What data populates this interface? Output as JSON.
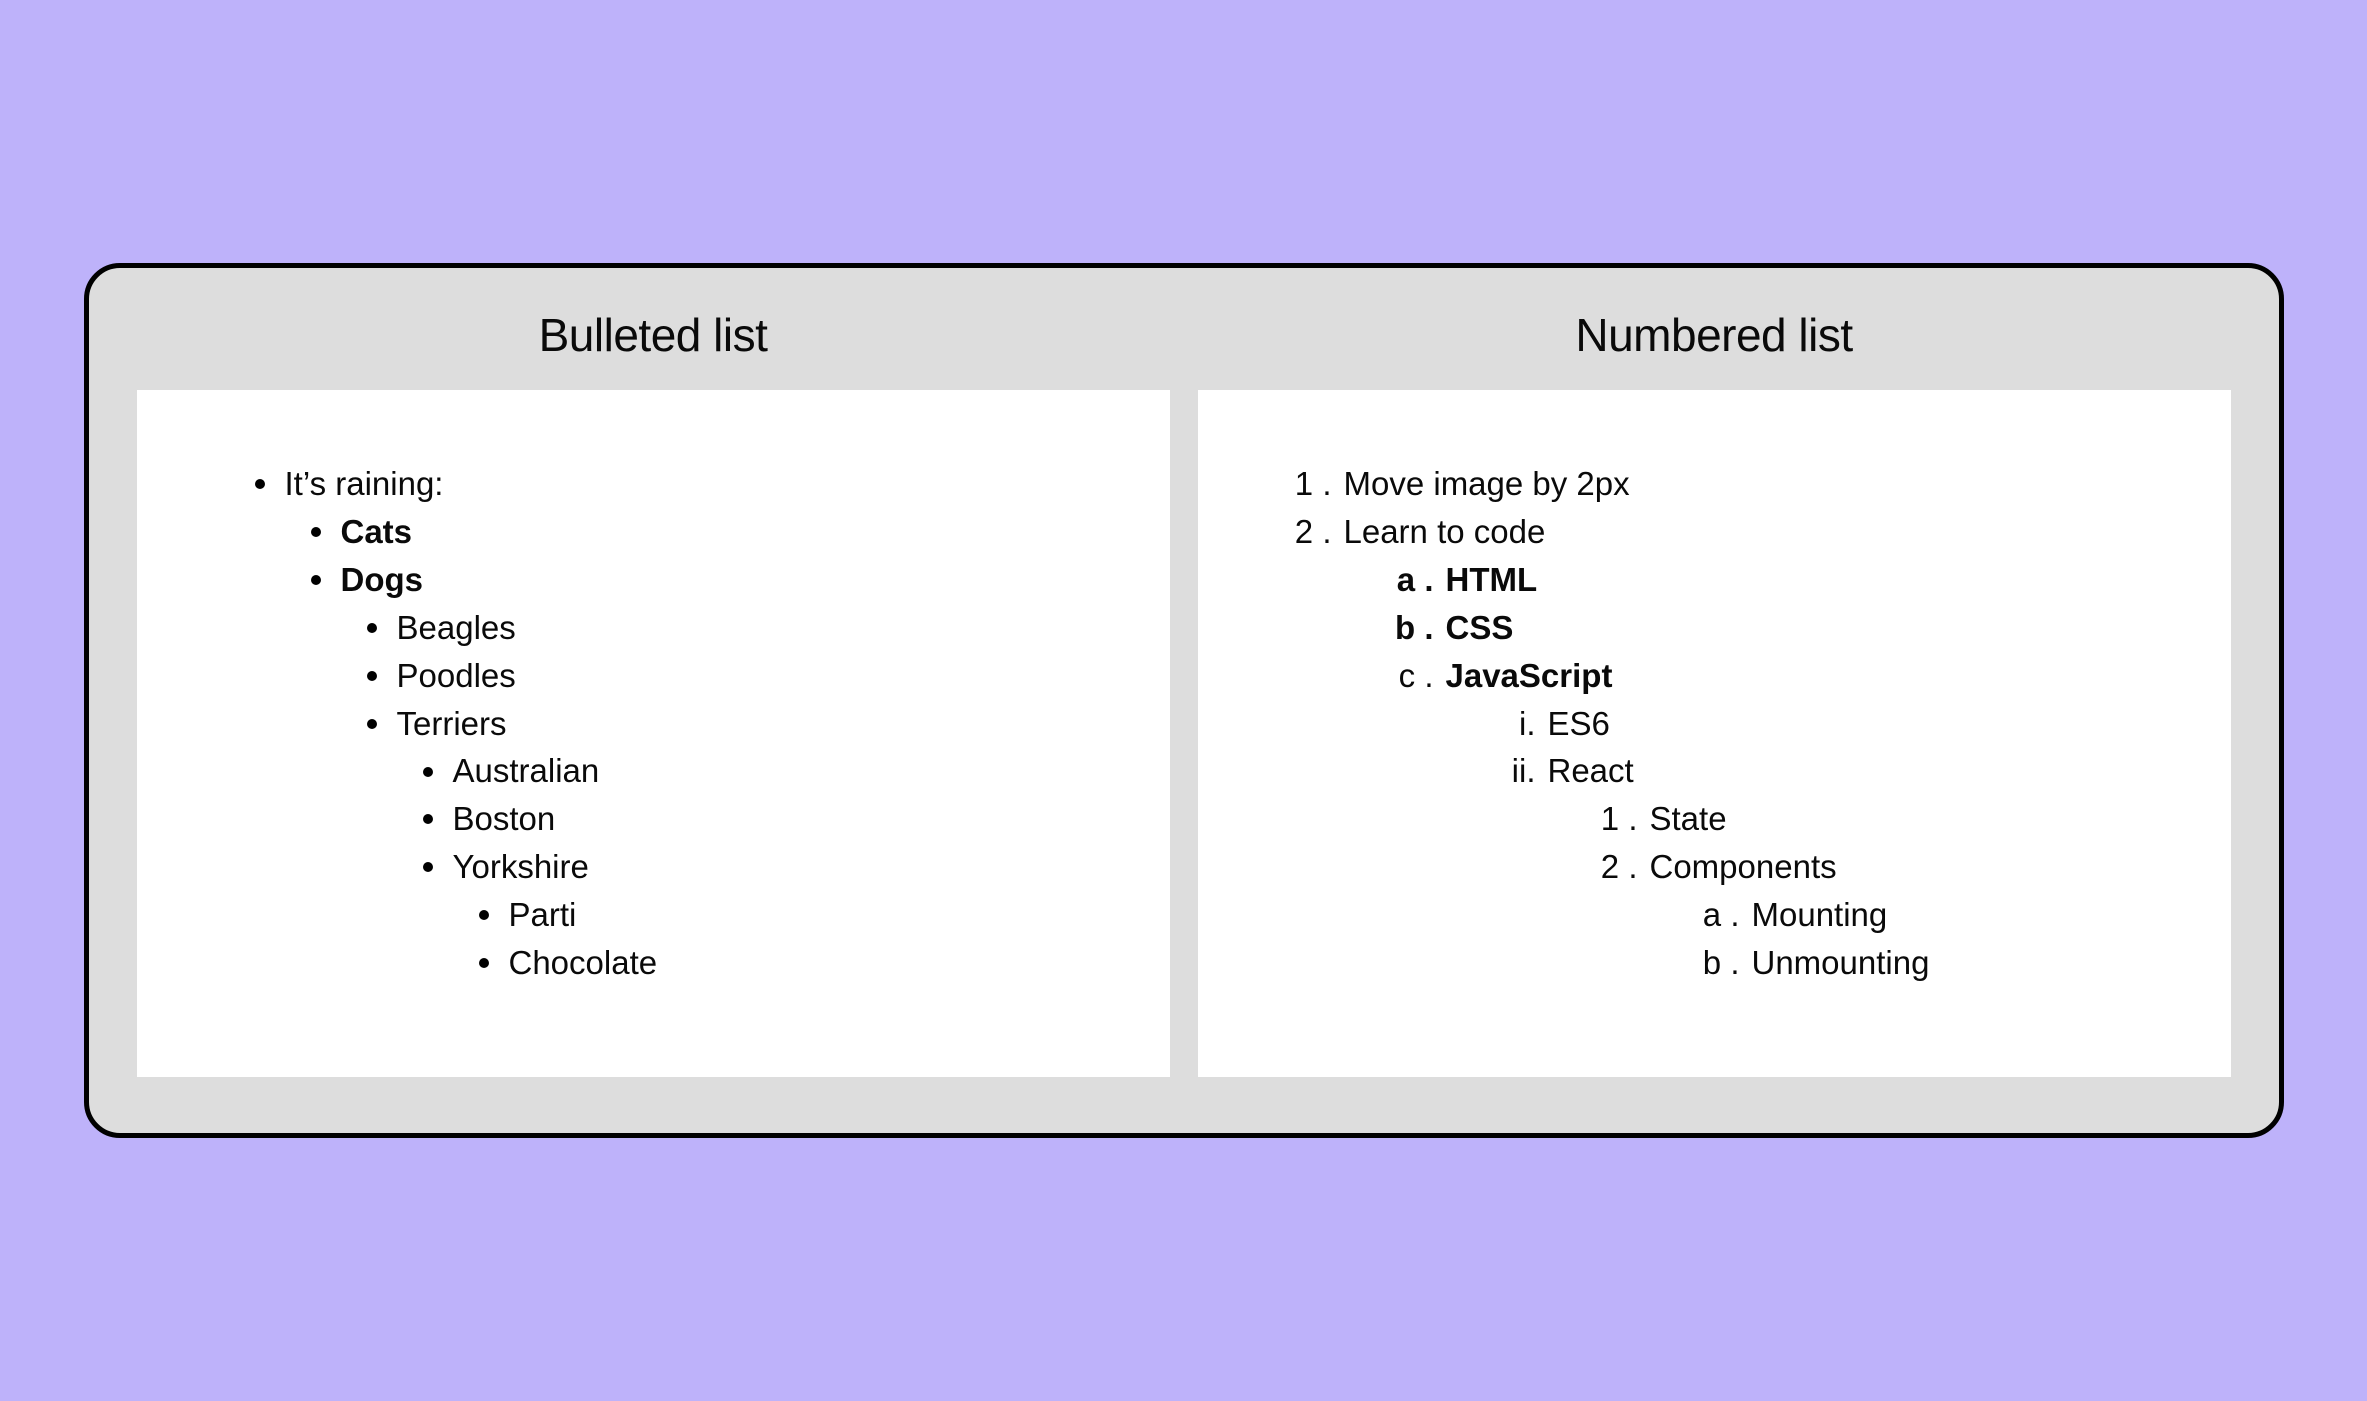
{
  "left": {
    "title": "Bulleted list",
    "items": {
      "root": "It’s raining:",
      "l2_0": "Cats",
      "l2_1": "Dogs",
      "l3_0": "Beagles",
      "l3_1": "Poodles",
      "l3_2": "Terriers",
      "l4_0": "Australian",
      "l4_1": "Boston",
      "l4_2": "Yorkshire",
      "l5_0": "Parti",
      "l5_1": "Chocolate"
    }
  },
  "right": {
    "title": "Numbered list",
    "items": {
      "n1": "Move image by 2px",
      "n2": "Learn to code",
      "a1": "HTML",
      "a2": "CSS",
      "a3": "JavaScript",
      "r1": "ES6",
      "r2": "React",
      "d1": "State",
      "d2": "Components",
      "aa1": "Mounting",
      "aa2": "Unmounting"
    }
  }
}
